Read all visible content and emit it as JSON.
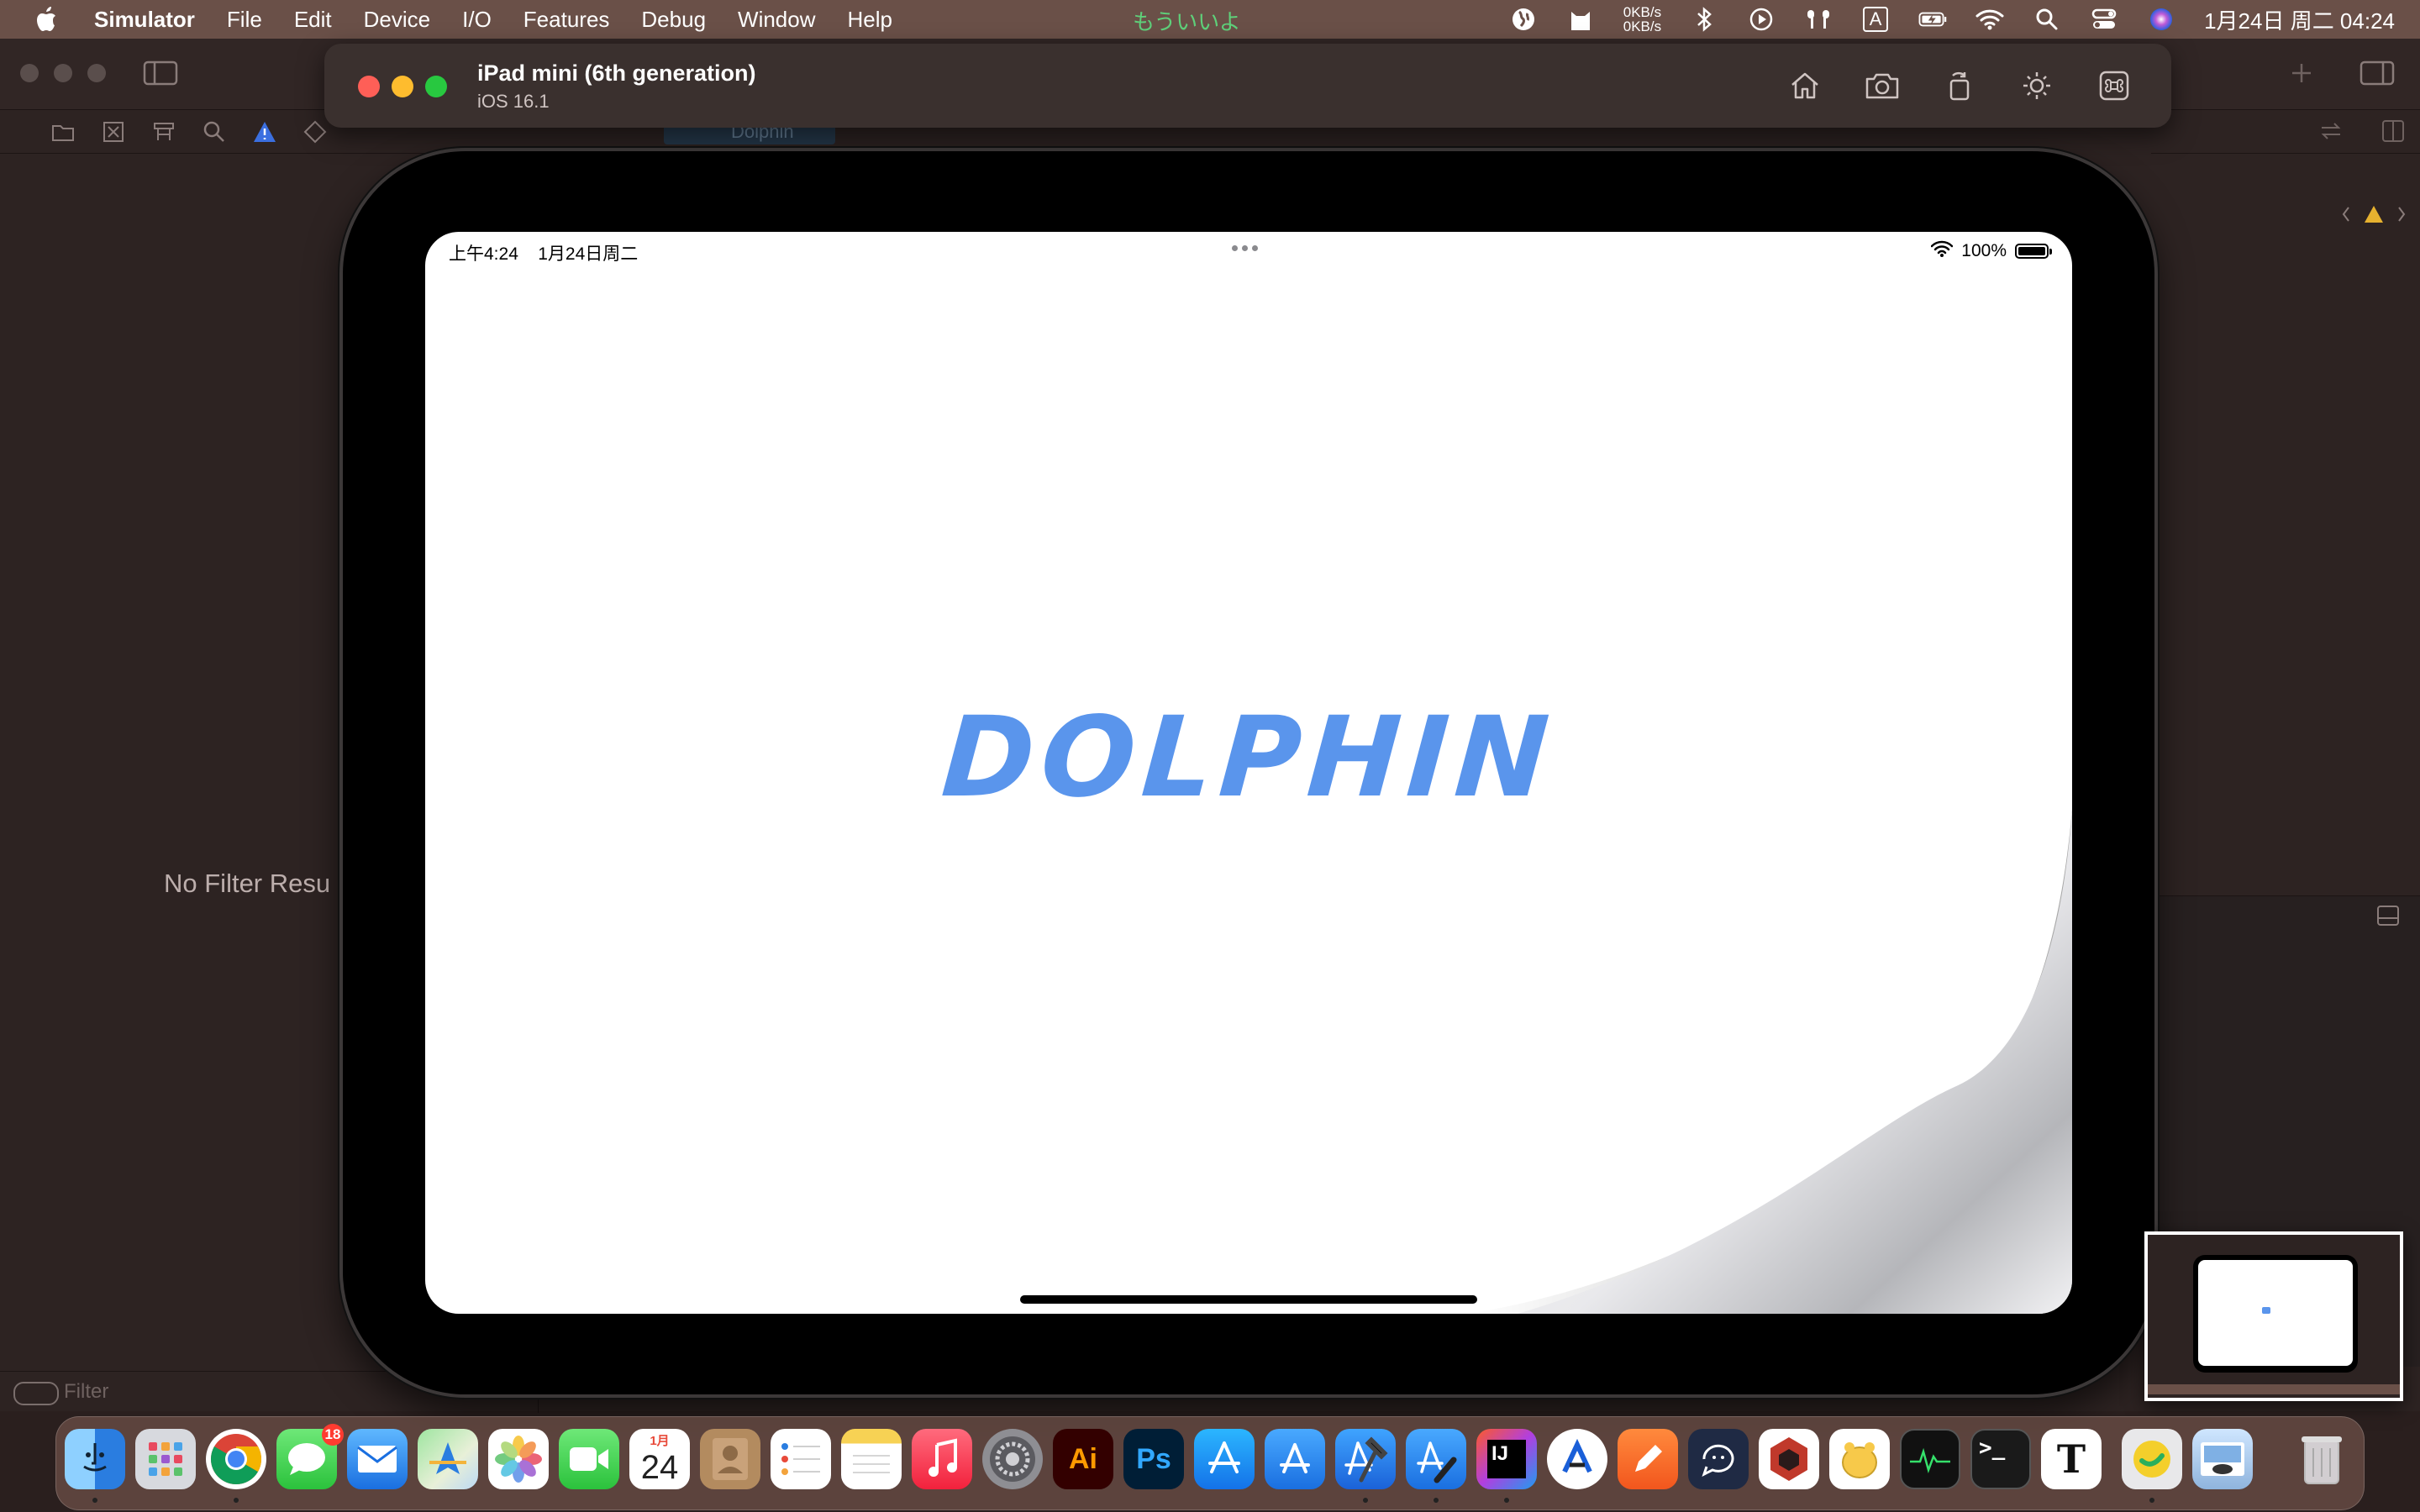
{
  "menubar": {
    "app_name": "Simulator",
    "items": [
      "File",
      "Edit",
      "Device",
      "I/O",
      "Features",
      "Debug",
      "Window",
      "Help"
    ],
    "center_text": "もういいよ",
    "net_up": "0KB/s",
    "net_down": "0KB/s",
    "clock": "1月24日 周二  04:24",
    "input_indicator": "A"
  },
  "xcode": {
    "sidebar_empty_text": "No Filter Resu",
    "filter_placeholder": "Filter",
    "editor_tab": "Dolphin"
  },
  "simulator": {
    "device_name": "iPad mini (6th generation)",
    "os_version": "iOS 16.1",
    "tools": [
      "home-icon",
      "screenshot-icon",
      "rotate-icon",
      "appearance-icon",
      "keyboard-command-icon"
    ]
  },
  "ios": {
    "status_time": "上午4:24",
    "status_date": "1月24日周二",
    "battery_percent": "100%",
    "battery_level": 1.0,
    "app_logo_text": "DOLPHIN",
    "logo_color": "#5a95ec"
  },
  "dock": {
    "messages_badge": "18",
    "calendar_month": "1月",
    "calendar_day": "24",
    "apps": [
      {
        "name": "finder",
        "label": ""
      },
      {
        "name": "launchpad",
        "label": ""
      },
      {
        "name": "chrome",
        "label": ""
      },
      {
        "name": "messages",
        "label": ""
      },
      {
        "name": "mail",
        "label": ""
      },
      {
        "name": "maps",
        "label": ""
      },
      {
        "name": "photos",
        "label": ""
      },
      {
        "name": "facetime",
        "label": ""
      },
      {
        "name": "calendar",
        "label": ""
      },
      {
        "name": "contacts",
        "label": ""
      },
      {
        "name": "reminders",
        "label": ""
      },
      {
        "name": "notes",
        "label": ""
      },
      {
        "name": "music",
        "label": ""
      },
      {
        "name": "system-settings",
        "label": ""
      },
      {
        "name": "illustrator",
        "label": "Ai"
      },
      {
        "name": "photoshop",
        "label": "Ps"
      },
      {
        "name": "app-store",
        "label": ""
      },
      {
        "name": "simulator-store",
        "label": ""
      },
      {
        "name": "xcode",
        "label": ""
      },
      {
        "name": "instruments",
        "label": ""
      },
      {
        "name": "intellij",
        "label": "IJ"
      },
      {
        "name": "vscode-like",
        "label": ""
      },
      {
        "name": "pencil-app",
        "label": ""
      },
      {
        "name": "chat-app",
        "label": ""
      },
      {
        "name": "hex-app",
        "label": ""
      },
      {
        "name": "navicat",
        "label": ""
      },
      {
        "name": "activity-monitor",
        "label": ""
      },
      {
        "name": "terminal",
        "label": ">_"
      },
      {
        "name": "typora",
        "label": "T"
      },
      {
        "name": "chat-bubble-app",
        "label": ""
      },
      {
        "name": "preview",
        "label": ""
      },
      {
        "name": "trash",
        "label": ""
      }
    ]
  },
  "colors": {
    "menubar_bg": "#6a5048",
    "accent_blue": "#5a95ec",
    "traffic_red": "#fe5f57",
    "traffic_yellow": "#febc2e",
    "traffic_green": "#28c840"
  }
}
